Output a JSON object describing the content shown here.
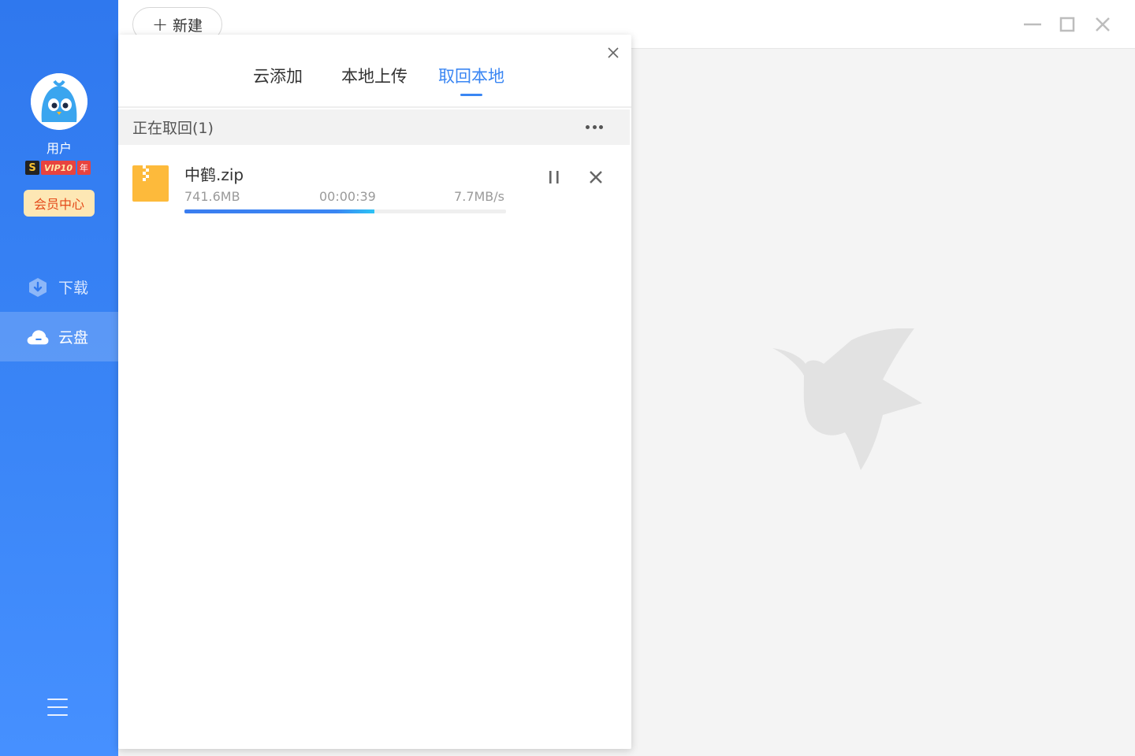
{
  "sidebar": {
    "user_name": "用户",
    "vip": {
      "s_label": "S",
      "level_label": "VIP10",
      "year_label": "年"
    },
    "member_center_label": "会员中心",
    "nav": [
      {
        "label": "下载",
        "icon": "download-shield-icon",
        "active": false
      },
      {
        "label": "云盘",
        "icon": "cloud-icon",
        "active": true
      }
    ],
    "menu_icon": "hamburger-menu-icon"
  },
  "toolbar": {
    "new_label": "新建",
    "new_icon": "plus-icon"
  },
  "window_controls": [
    "minimize-icon",
    "maximize-icon",
    "close-icon"
  ],
  "panel": {
    "tabs": [
      {
        "label": "云添加",
        "active": false
      },
      {
        "label": "本地上传",
        "active": false
      },
      {
        "label": "取回本地",
        "active": true
      }
    ],
    "section_title": "正在取回(1)",
    "tasks": [
      {
        "file_name": "中鹤.zip",
        "size": "741.6MB",
        "time_left": "00:00:39",
        "speed": "7.7MB/s",
        "progress": 0.59,
        "file_type_icon": "zip-file-icon"
      }
    ]
  },
  "colors": {
    "accent": "#3a86f3",
    "sidebar_top": "#2f78ee",
    "sidebar_bottom": "#4690ff",
    "zip_icon": "#fdba3b",
    "member_bg": "#fde7b4",
    "member_text": "#e44a1a",
    "vip_red": "#e8433f"
  }
}
